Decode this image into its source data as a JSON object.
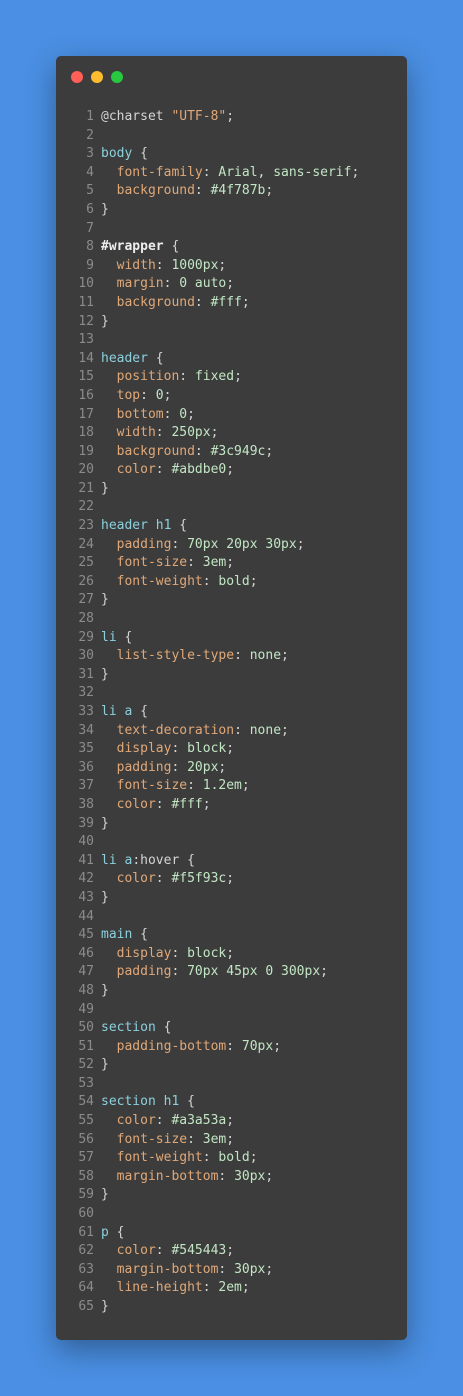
{
  "window": {
    "controls": [
      {
        "name": "close",
        "color": "#ff5f57"
      },
      {
        "name": "minimize",
        "color": "#febc2e"
      },
      {
        "name": "maximize",
        "color": "#28c840"
      }
    ]
  },
  "theme": {
    "background": "#4a8fe3",
    "editor_bg": "#3c3c3c",
    "selector": "#8bd0dd",
    "property": "#e0a878",
    "value": "#c2e6c4",
    "line_number": "#8b8b8b"
  },
  "code_lines": [
    [
      {
        "t": "@charset ",
        "c": "at"
      },
      {
        "t": "\"UTF-8\"",
        "c": "str"
      },
      {
        "t": ";",
        "c": "punc"
      }
    ],
    [],
    [
      {
        "t": "body",
        "c": "sel"
      },
      {
        "t": " {",
        "c": "punc"
      }
    ],
    [
      {
        "t": "  font-family",
        "c": "prop"
      },
      {
        "t": ": ",
        "c": "punc"
      },
      {
        "t": "Arial, sans-serif",
        "c": "val"
      },
      {
        "t": ";",
        "c": "punc"
      }
    ],
    [
      {
        "t": "  background",
        "c": "prop"
      },
      {
        "t": ": ",
        "c": "punc"
      },
      {
        "t": "#4f787b",
        "c": "val"
      },
      {
        "t": ";",
        "c": "punc"
      }
    ],
    [
      {
        "t": "}",
        "c": "punc"
      }
    ],
    [],
    [
      {
        "t": "#wrapper",
        "c": "id"
      },
      {
        "t": " {",
        "c": "punc"
      }
    ],
    [
      {
        "t": "  width",
        "c": "prop"
      },
      {
        "t": ": ",
        "c": "punc"
      },
      {
        "t": "1000px",
        "c": "val"
      },
      {
        "t": ";",
        "c": "punc"
      }
    ],
    [
      {
        "t": "  margin",
        "c": "prop"
      },
      {
        "t": ": ",
        "c": "punc"
      },
      {
        "t": "0 auto",
        "c": "val"
      },
      {
        "t": ";",
        "c": "punc"
      }
    ],
    [
      {
        "t": "  background",
        "c": "prop"
      },
      {
        "t": ": ",
        "c": "punc"
      },
      {
        "t": "#fff",
        "c": "val"
      },
      {
        "t": ";",
        "c": "punc"
      }
    ],
    [
      {
        "t": "}",
        "c": "punc"
      }
    ],
    [],
    [
      {
        "t": "header",
        "c": "sel"
      },
      {
        "t": " {",
        "c": "punc"
      }
    ],
    [
      {
        "t": "  position",
        "c": "prop"
      },
      {
        "t": ": ",
        "c": "punc"
      },
      {
        "t": "fixed",
        "c": "val"
      },
      {
        "t": ";",
        "c": "punc"
      }
    ],
    [
      {
        "t": "  top",
        "c": "prop"
      },
      {
        "t": ": ",
        "c": "punc"
      },
      {
        "t": "0",
        "c": "val"
      },
      {
        "t": ";",
        "c": "punc"
      }
    ],
    [
      {
        "t": "  bottom",
        "c": "prop"
      },
      {
        "t": ": ",
        "c": "punc"
      },
      {
        "t": "0",
        "c": "val"
      },
      {
        "t": ";",
        "c": "punc"
      }
    ],
    [
      {
        "t": "  width",
        "c": "prop"
      },
      {
        "t": ": ",
        "c": "punc"
      },
      {
        "t": "250px",
        "c": "val"
      },
      {
        "t": ";",
        "c": "punc"
      }
    ],
    [
      {
        "t": "  background",
        "c": "prop"
      },
      {
        "t": ": ",
        "c": "punc"
      },
      {
        "t": "#3c949c",
        "c": "val"
      },
      {
        "t": ";",
        "c": "punc"
      }
    ],
    [
      {
        "t": "  color",
        "c": "prop"
      },
      {
        "t": ": ",
        "c": "punc"
      },
      {
        "t": "#abdbe0",
        "c": "val"
      },
      {
        "t": ";",
        "c": "punc"
      }
    ],
    [
      {
        "t": "}",
        "c": "punc"
      }
    ],
    [],
    [
      {
        "t": "header h1",
        "c": "sel"
      },
      {
        "t": " {",
        "c": "punc"
      }
    ],
    [
      {
        "t": "  padding",
        "c": "prop"
      },
      {
        "t": ": ",
        "c": "punc"
      },
      {
        "t": "70px 20px 30px",
        "c": "val"
      },
      {
        "t": ";",
        "c": "punc"
      }
    ],
    [
      {
        "t": "  font-size",
        "c": "prop"
      },
      {
        "t": ": ",
        "c": "punc"
      },
      {
        "t": "3em",
        "c": "val"
      },
      {
        "t": ";",
        "c": "punc"
      }
    ],
    [
      {
        "t": "  font-weight",
        "c": "prop"
      },
      {
        "t": ": ",
        "c": "punc"
      },
      {
        "t": "bold",
        "c": "val"
      },
      {
        "t": ";",
        "c": "punc"
      }
    ],
    [
      {
        "t": "}",
        "c": "punc"
      }
    ],
    [],
    [
      {
        "t": "li",
        "c": "sel"
      },
      {
        "t": " {",
        "c": "punc"
      }
    ],
    [
      {
        "t": "  list-style-type",
        "c": "prop"
      },
      {
        "t": ": ",
        "c": "punc"
      },
      {
        "t": "none",
        "c": "val"
      },
      {
        "t": ";",
        "c": "punc"
      }
    ],
    [
      {
        "t": "}",
        "c": "punc"
      }
    ],
    [],
    [
      {
        "t": "li a",
        "c": "sel"
      },
      {
        "t": " {",
        "c": "punc"
      }
    ],
    [
      {
        "t": "  text-decoration",
        "c": "prop"
      },
      {
        "t": ": ",
        "c": "punc"
      },
      {
        "t": "none",
        "c": "val"
      },
      {
        "t": ";",
        "c": "punc"
      }
    ],
    [
      {
        "t": "  display",
        "c": "prop"
      },
      {
        "t": ": ",
        "c": "punc"
      },
      {
        "t": "block",
        "c": "val"
      },
      {
        "t": ";",
        "c": "punc"
      }
    ],
    [
      {
        "t": "  padding",
        "c": "prop"
      },
      {
        "t": ": ",
        "c": "punc"
      },
      {
        "t": "20px",
        "c": "val"
      },
      {
        "t": ";",
        "c": "punc"
      }
    ],
    [
      {
        "t": "  font-size",
        "c": "prop"
      },
      {
        "t": ": ",
        "c": "punc"
      },
      {
        "t": "1.2em",
        "c": "val"
      },
      {
        "t": ";",
        "c": "punc"
      }
    ],
    [
      {
        "t": "  color",
        "c": "prop"
      },
      {
        "t": ": ",
        "c": "punc"
      },
      {
        "t": "#fff",
        "c": "val"
      },
      {
        "t": ";",
        "c": "punc"
      }
    ],
    [
      {
        "t": "}",
        "c": "punc"
      }
    ],
    [],
    [
      {
        "t": "li a",
        "c": "sel"
      },
      {
        "t": ":hover",
        "c": "pseudo"
      },
      {
        "t": " {",
        "c": "punc"
      }
    ],
    [
      {
        "t": "  color",
        "c": "prop"
      },
      {
        "t": ": ",
        "c": "punc"
      },
      {
        "t": "#f5f93c",
        "c": "val"
      },
      {
        "t": ";",
        "c": "punc"
      }
    ],
    [
      {
        "t": "}",
        "c": "punc"
      }
    ],
    [],
    [
      {
        "t": "main",
        "c": "sel"
      },
      {
        "t": " {",
        "c": "punc"
      }
    ],
    [
      {
        "t": "  display",
        "c": "prop"
      },
      {
        "t": ": ",
        "c": "punc"
      },
      {
        "t": "block",
        "c": "val"
      },
      {
        "t": ";",
        "c": "punc"
      }
    ],
    [
      {
        "t": "  padding",
        "c": "prop"
      },
      {
        "t": ": ",
        "c": "punc"
      },
      {
        "t": "70px 45px 0 300px",
        "c": "val"
      },
      {
        "t": ";",
        "c": "punc"
      }
    ],
    [
      {
        "t": "}",
        "c": "punc"
      }
    ],
    [],
    [
      {
        "t": "section",
        "c": "sel"
      },
      {
        "t": " {",
        "c": "punc"
      }
    ],
    [
      {
        "t": "  padding-bottom",
        "c": "prop"
      },
      {
        "t": ": ",
        "c": "punc"
      },
      {
        "t": "70px",
        "c": "val"
      },
      {
        "t": ";",
        "c": "punc"
      }
    ],
    [
      {
        "t": "}",
        "c": "punc"
      }
    ],
    [],
    [
      {
        "t": "section h1",
        "c": "sel"
      },
      {
        "t": " {",
        "c": "punc"
      }
    ],
    [
      {
        "t": "  color",
        "c": "prop"
      },
      {
        "t": ": ",
        "c": "punc"
      },
      {
        "t": "#a3a53a",
        "c": "val"
      },
      {
        "t": ";",
        "c": "punc"
      }
    ],
    [
      {
        "t": "  font-size",
        "c": "prop"
      },
      {
        "t": ": ",
        "c": "punc"
      },
      {
        "t": "3em",
        "c": "val"
      },
      {
        "t": ";",
        "c": "punc"
      }
    ],
    [
      {
        "t": "  font-weight",
        "c": "prop"
      },
      {
        "t": ": ",
        "c": "punc"
      },
      {
        "t": "bold",
        "c": "val"
      },
      {
        "t": ";",
        "c": "punc"
      }
    ],
    [
      {
        "t": "  margin-bottom",
        "c": "prop"
      },
      {
        "t": ": ",
        "c": "punc"
      },
      {
        "t": "30px",
        "c": "val"
      },
      {
        "t": ";",
        "c": "punc"
      }
    ],
    [
      {
        "t": "}",
        "c": "punc"
      }
    ],
    [],
    [
      {
        "t": "p",
        "c": "sel"
      },
      {
        "t": " {",
        "c": "punc"
      }
    ],
    [
      {
        "t": "  color",
        "c": "prop"
      },
      {
        "t": ": ",
        "c": "punc"
      },
      {
        "t": "#545443",
        "c": "val"
      },
      {
        "t": ";",
        "c": "punc"
      }
    ],
    [
      {
        "t": "  margin-bottom",
        "c": "prop"
      },
      {
        "t": ": ",
        "c": "punc"
      },
      {
        "t": "30px",
        "c": "val"
      },
      {
        "t": ";",
        "c": "punc"
      }
    ],
    [
      {
        "t": "  line-height",
        "c": "prop"
      },
      {
        "t": ": ",
        "c": "punc"
      },
      {
        "t": "2em",
        "c": "val"
      },
      {
        "t": ";",
        "c": "punc"
      }
    ],
    [
      {
        "t": "}",
        "c": "punc"
      }
    ]
  ]
}
